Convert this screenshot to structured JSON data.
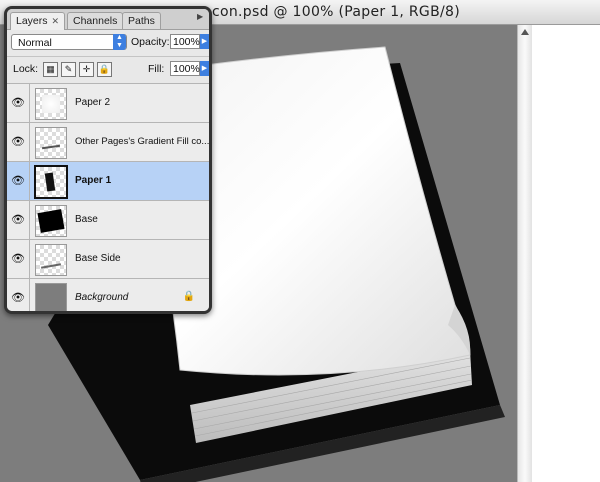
{
  "document": {
    "title": "con.psd @ 100% (Paper 1, RGB/8)"
  },
  "panel": {
    "tabs": [
      {
        "label": "Layers",
        "active": true
      },
      {
        "label": "Channels",
        "active": false
      },
      {
        "label": "Paths",
        "active": false
      }
    ],
    "blend_mode": "Normal",
    "opacity_label": "Opacity:",
    "opacity_value": "100%",
    "lock_label": "Lock:",
    "fill_label": "Fill:",
    "fill_value": "100%",
    "layers": [
      {
        "name": "Paper 2",
        "visible": true,
        "selected": false
      },
      {
        "name": "Other Pages's Gradient Fill co...",
        "visible": true,
        "selected": false
      },
      {
        "name": "Paper 1",
        "visible": true,
        "selected": true
      },
      {
        "name": "Base",
        "visible": true,
        "selected": false
      },
      {
        "name": "Base Side",
        "visible": true,
        "selected": false
      },
      {
        "name": "Background",
        "visible": true,
        "selected": false,
        "locked": true
      }
    ]
  },
  "colors": {
    "canvas_bg": "#7d7d7d",
    "selection": "#b7d2f6",
    "accent_blue": "#3d7fe0"
  }
}
